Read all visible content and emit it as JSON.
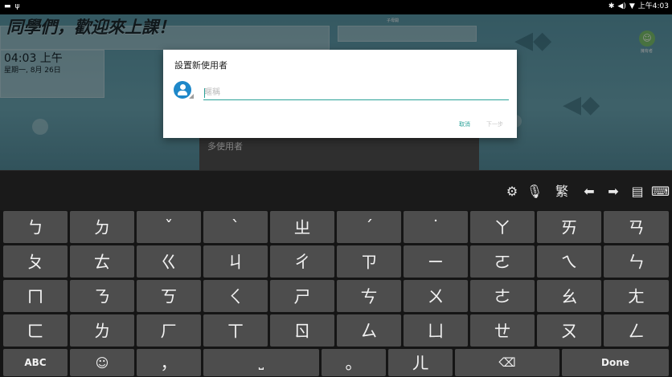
{
  "status_bar": {
    "left_icons": [
      "image-icon",
      "usb-icon"
    ],
    "right_icons": [
      "bluetooth-icon",
      "volume-icon",
      "wifi-icon"
    ],
    "time": "上午4:03"
  },
  "home": {
    "welcome_title": "同學們，歡迎來上課！",
    "clock_time": "04:03 上午",
    "clock_date": "星期一, 8月 26日",
    "small_tile_label": "子母開",
    "avatar_label": "擁有者",
    "multiuser_label": "多使用者"
  },
  "dialog": {
    "title": "設置新使用者",
    "name_placeholder": "暱稱",
    "name_value": "",
    "cancel_label": "取消",
    "next_label": "下一步"
  },
  "keyboard": {
    "toolbar": [
      {
        "name": "settings-icon",
        "glyph": "⚙"
      },
      {
        "name": "microphone-icon",
        "glyph": "🎙"
      },
      {
        "name": "traditional-toggle",
        "glyph": "繁"
      },
      {
        "name": "arrow-left-icon",
        "glyph": "⬅"
      },
      {
        "name": "arrow-right-icon",
        "glyph": "➡"
      },
      {
        "name": "clipboard-icon",
        "glyph": "▤"
      },
      {
        "name": "keyboard-icon",
        "glyph": "⌨"
      }
    ],
    "rows": [
      [
        "ㄅ",
        "ㄉ",
        "ˇ",
        "ˋ",
        "ㄓ",
        "ˊ",
        "˙",
        "ㄚ",
        "ㄞ",
        "ㄢ"
      ],
      [
        "ㄆ",
        "ㄊ",
        "ㄍ",
        "ㄐ",
        "ㄔ",
        "ㄗ",
        "ㄧ",
        "ㄛ",
        "ㄟ",
        "ㄣ"
      ],
      [
        "ㄇ",
        "ㄋ",
        "ㄎ",
        "ㄑ",
        "ㄕ",
        "ㄘ",
        "ㄨ",
        "ㄜ",
        "ㄠ",
        "ㄤ"
      ],
      [
        "ㄈ",
        "ㄌ",
        "ㄏ",
        "ㄒ",
        "ㄖ",
        "ㄙ",
        "ㄩ",
        "ㄝ",
        "ㄡ",
        "ㄥ"
      ]
    ],
    "bottom_row": {
      "abc": "ABC",
      "emoji_icon": "emoji-icon",
      "comma": "，",
      "space_icon": "space-icon",
      "period": "。",
      "er": "ㄦ",
      "backspace_icon": "backspace-icon",
      "done": "Done"
    }
  }
}
